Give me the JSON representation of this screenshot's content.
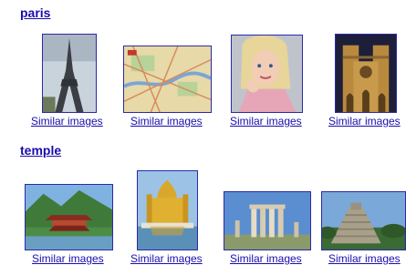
{
  "groups": [
    {
      "query": "paris",
      "images": [
        {
          "subject": "eiffel-tower",
          "link": "Similar images"
        },
        {
          "subject": "paris-map",
          "link": "Similar images"
        },
        {
          "subject": "paris-hilton",
          "link": "Similar images"
        },
        {
          "subject": "notre-dame",
          "link": "Similar images"
        }
      ]
    },
    {
      "query": "temple",
      "images": [
        {
          "subject": "pagoda-temple",
          "link": "Similar images"
        },
        {
          "subject": "golden-temple",
          "link": "Similar images"
        },
        {
          "subject": "greek-columns",
          "link": "Similar images"
        },
        {
          "subject": "mayan-pyramid",
          "link": "Similar images"
        }
      ]
    }
  ],
  "colors": {
    "link": "#1a0dab",
    "thumb_border": "#2a2aa8"
  }
}
